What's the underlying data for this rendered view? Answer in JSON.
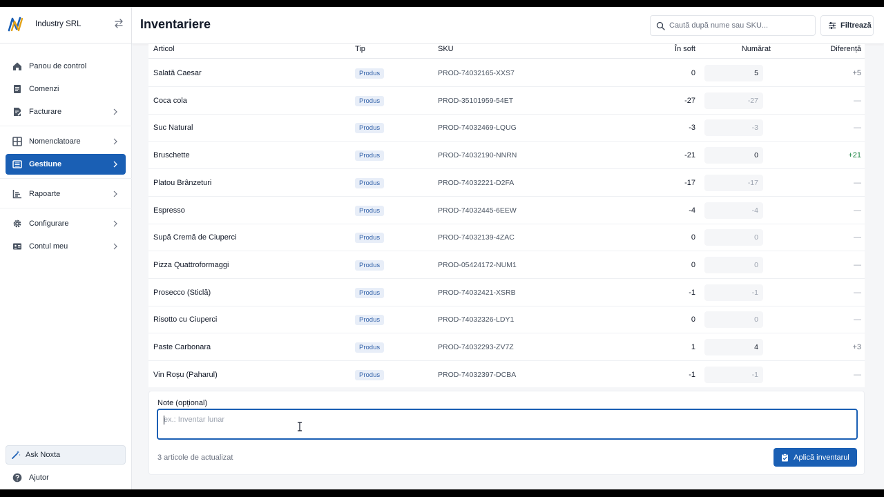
{
  "sidebar": {
    "company": "Industry SRL",
    "items": [
      {
        "label": "Panou de control",
        "icon": "home-icon"
      },
      {
        "label": "Comenzi",
        "icon": "document-icon"
      },
      {
        "label": "Facturare",
        "icon": "invoice-icon"
      },
      {
        "label": "Nomenclatoare",
        "icon": "grid-icon"
      },
      {
        "label": "Gestiune",
        "icon": "warehouse-icon",
        "active": true
      },
      {
        "label": "Rapoarte",
        "icon": "chart-icon"
      },
      {
        "label": "Configurare",
        "icon": "gear-icon"
      },
      {
        "label": "Contul meu",
        "icon": "id-card-icon"
      }
    ],
    "ask_label": "Ask Noxta",
    "help_label": "Ajutor"
  },
  "header": {
    "title": "Inventariere",
    "search_placeholder": "Caută după nume sau SKU...",
    "filter_label": "Filtrează"
  },
  "table": {
    "columns": {
      "articol": "Articol",
      "tip": "Tip",
      "sku": "SKU",
      "soft": "În soft",
      "numarat": "Numărat",
      "diferenta": "Diferență"
    },
    "rows": [
      {
        "name": "Salată Caesar",
        "tip": "Produs",
        "sku": "PROD-74032165-XXS7",
        "soft": "0",
        "count": "5",
        "diff": "+5"
      },
      {
        "name": "Coca cola",
        "tip": "Produs",
        "sku": "PROD-35101959-54ET",
        "soft": "-27",
        "count": "-27",
        "diff": "—"
      },
      {
        "name": "Suc Natural",
        "tip": "Produs",
        "sku": "PROD-74032469-LQUG",
        "soft": "-3",
        "count": "-3",
        "diff": "—"
      },
      {
        "name": "Bruschette",
        "tip": "Produs",
        "sku": "PROD-74032190-NNRN",
        "soft": "-21",
        "count": "0",
        "diff": "+21"
      },
      {
        "name": "Platou Brânzeturi",
        "tip": "Produs",
        "sku": "PROD-74032221-D2FA",
        "soft": "-17",
        "count": "-17",
        "diff": "—"
      },
      {
        "name": "Espresso",
        "tip": "Produs",
        "sku": "PROD-74032445-6EEW",
        "soft": "-4",
        "count": "-4",
        "diff": "—"
      },
      {
        "name": "Supă Cremă de Ciuperci",
        "tip": "Produs",
        "sku": "PROD-74032139-4ZAC",
        "soft": "0",
        "count": "0",
        "diff": "—"
      },
      {
        "name": "Pizza Quattroformaggi",
        "tip": "Produs",
        "sku": "PROD-05424172-NUM1",
        "soft": "0",
        "count": "0",
        "diff": "—"
      },
      {
        "name": "Prosecco (Sticlă)",
        "tip": "Produs",
        "sku": "PROD-74032421-XSRB",
        "soft": "-1",
        "count": "-1",
        "diff": "—"
      },
      {
        "name": "Risotto cu Ciuperci",
        "tip": "Produs",
        "sku": "PROD-74032326-LDY1",
        "soft": "0",
        "count": "0",
        "diff": "—"
      },
      {
        "name": "Paste Carbonara",
        "tip": "Produs",
        "sku": "PROD-74032293-ZV7Z",
        "soft": "1",
        "count": "4",
        "diff": "+3"
      },
      {
        "name": "Vin Roșu (Paharul)",
        "tip": "Produs",
        "sku": "PROD-74032397-DCBA",
        "soft": "-1",
        "count": "-1",
        "diff": "—"
      }
    ]
  },
  "footer": {
    "note_label": "Note (opțional)",
    "note_placeholder": "ex.: Inventar lunar",
    "note_value": "",
    "summary": "3 articole de actualizat",
    "apply_label": "Aplică inventarul"
  },
  "colors": {
    "accent": "#1a5fb4",
    "positive": "#15803d",
    "badge_bg": "#e8eef8"
  }
}
